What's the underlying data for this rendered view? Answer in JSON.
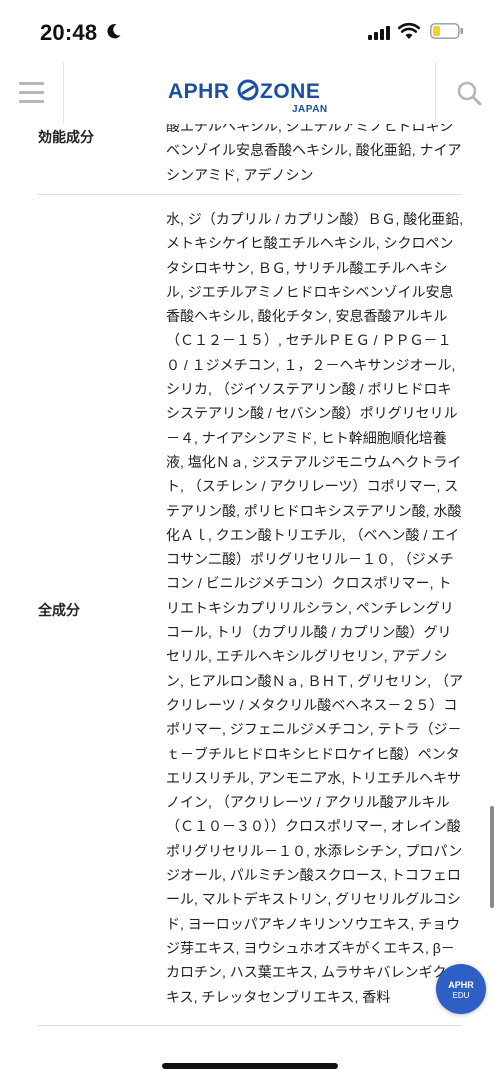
{
  "status_bar": {
    "time": "20:48",
    "battery_color": "#f3d22b"
  },
  "header": {
    "logo": {
      "left": "APHR",
      "right": "ZONE",
      "sub": "JAPAN",
      "color": "#1b4fa3"
    },
    "menu_icon": "hamburger-icon",
    "search_icon": "search-icon"
  },
  "table": [
    {
      "label": "効能成分",
      "value": "酸エチルヘキシル, ジエチルアミノヒドロキシベンゾイル安息香酸ヘキシル, 酸化亜鉛, ナイアシンアミド, アデノシン"
    },
    {
      "label": "全成分",
      "value": "水, ジ（カプリル / カプリン酸）ＢＧ, 酸化亜鉛, メトキシケイヒ酸エチルヘキシル, シクロペンタシロキサン, ＢＧ, サリチル酸エチルヘキシル, ジエチルアミノヒドロキシベンゾイル安息香酸ヘキシル, 酸化チタン, 安息香酸アルキル（Ｃ１２－１５）, セチルＰＥＧ / ＰＰＧ－１０ / １ジメチコン, １，２－ヘキサンジオール, シリカ, （ジイソステアリン酸 / ポリヒドロキシステアリン酸 / セバシン酸）ポリグリセリル－４, ナイアシンアミド, ヒト幹細胞順化培養液, 塩化Ｎａ, ジステアルジモニウムヘクトライト, （スチレン / アクリレーツ）コポリマー, ステアリン酸, ポリヒドロキシステアリン酸, 水酸化Ａｌ, クエン酸トリエチル, （ベヘン酸 / エイコサン二酸）ポリグリセリル－１０, （ジメチコン / ビニルジメチコン）クロスポリマー, トリエトキシカプリリルシラン, ペンチレングリコール, トリ（カプリル酸 / カプリン酸）グリセリル, エチルヘキシルグリセリン, アデノシン, ヒアルロン酸Ｎａ, ＢＨＴ, グリセリン, （アクリレーツ / メタクリル酸ベヘネス－２５）コポリマー, ジフェニルジメチコン, テトラ（ジ－ｔ－ブチルヒドロキシヒドロケイヒ酸）ペンタエリスリチル, アンモニア水, トリエチルヘキサノイン, （アクリレーツ / アクリル酸アルキル（Ｃ１０－３０））クロスポリマー, オレイン酸ポリグリセリル－１０, 水添レシチン, プロパンジオール, パルミチン酸スクロース, トコフェロール, マルトデキストリン, グリセリルグルコシド, ヨーロッパアキノキリンソウエキス, チョウジ芽エキス, ヨウシュホオズキがくエキス, β－カロチン, ハス葉エキス, ムラサキバレンギクエキス, チレッタセンブリエキス, 香料"
    }
  ],
  "badge": {
    "line1": "APHR",
    "line2": "EDU",
    "color": "#2f5fc4"
  }
}
